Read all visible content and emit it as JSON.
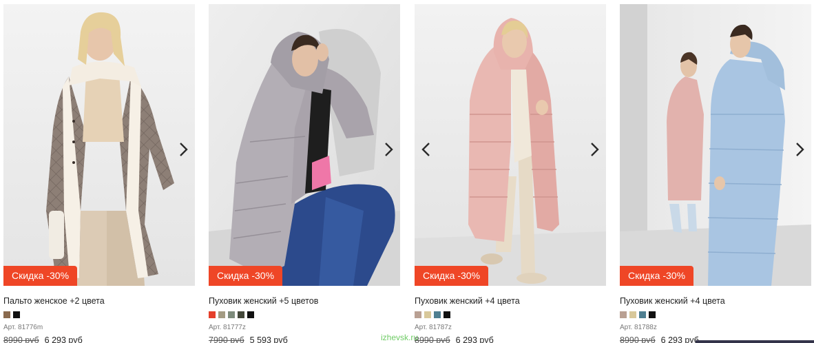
{
  "products": [
    {
      "discount_label": "Скидка -30%",
      "title": "Пальто женское +2 цвета",
      "article": "Арт. 81776m",
      "old_price": "8990 руб",
      "new_price": "6 293 руб",
      "swatch_colors": [
        "#8a6a4e",
        "#111111"
      ],
      "has_prev_arrow": false
    },
    {
      "discount_label": "Скидка -30%",
      "title": "Пуховик женский +5 цветов",
      "article": "Арт. 81777z",
      "old_price": "7990 руб",
      "new_price": "5 593 руб",
      "swatch_colors": [
        "#e5402b",
        "#a39b83",
        "#7d8b7b",
        "#44483a",
        "#111111"
      ],
      "has_prev_arrow": false
    },
    {
      "discount_label": "Скидка -30%",
      "title": "Пуховик женский +4 цвета",
      "article": "Арт. 81787z",
      "old_price": "8990 руб",
      "new_price": "6 293 руб",
      "swatch_colors": [
        "#b9a093",
        "#d8c89a",
        "#4f7f91",
        "#111111"
      ],
      "has_prev_arrow": true
    },
    {
      "discount_label": "Скидка -30%",
      "title": "Пуховик женский +4 цвета",
      "article": "Арт. 81788z",
      "old_price": "8990 руб",
      "new_price": "6 293 руб",
      "swatch_colors": [
        "#b9a093",
        "#d8c89a",
        "#4f7f91",
        "#111111"
      ],
      "has_prev_arrow": false
    }
  ],
  "watermark": "izhevsk.ru",
  "colors": {
    "badge": "#ef4626",
    "accent_watermark": "#55c24a"
  },
  "icons": {
    "next": "chevron-right-icon",
    "prev": "chevron-left-icon"
  }
}
